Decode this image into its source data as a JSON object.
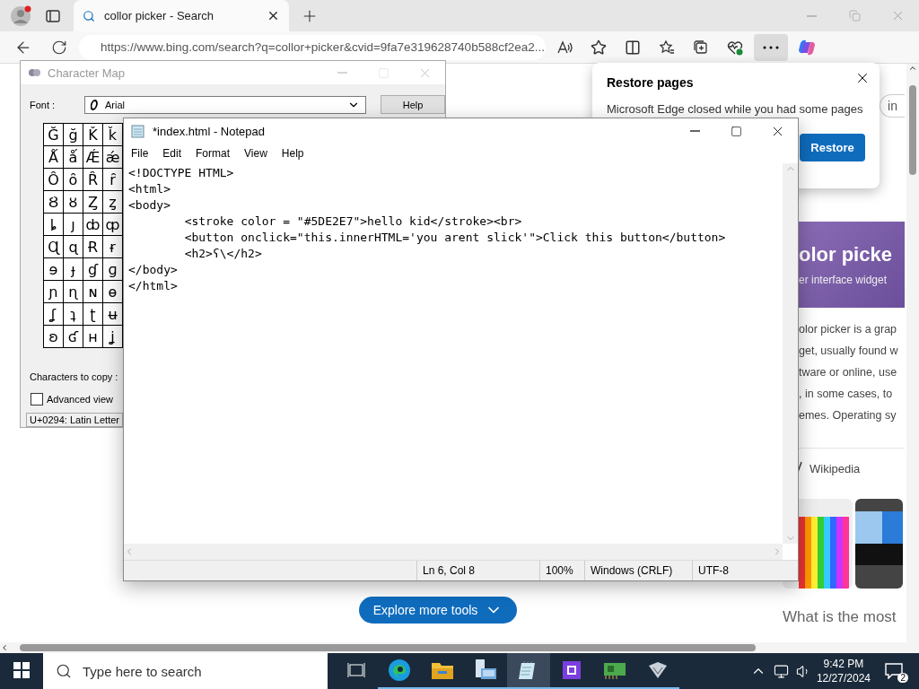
{
  "browser": {
    "tabs": [
      {
        "title": "collor picker - Search",
        "selected": true
      }
    ],
    "address": "https://www.bing.com/search?q=collor+picker&cvid=9fa7e319628740b588cf2ea2...",
    "toolbar": [
      {
        "kind": "read",
        "selected": false
      },
      {
        "kind": "star",
        "selected": false
      },
      {
        "kind": "split",
        "selected": false
      },
      {
        "kind": "favorites",
        "selected": false
      },
      {
        "kind": "collections",
        "selected": false
      },
      {
        "kind": "heart",
        "selected": false
      },
      {
        "kind": "more",
        "selected": true
      },
      {
        "kind": "copilot",
        "selected": false
      }
    ],
    "restore_popup": {
      "title": "Restore pages",
      "message": "Microsoft Edge closed while you had some pages",
      "button": "Restore"
    },
    "page": {
      "sign_in_partial": "in",
      "card_title": "olor picke",
      "card_subtitle": "er interface widget",
      "description": [
        "olor picker is a grap",
        "get, usually found w",
        "tware or online, use",
        ", in some cases, to",
        "emes. Operating sy"
      ],
      "source": "Wikipedia",
      "explore_button": "Explore more tools",
      "question": "What is the most"
    }
  },
  "character_map": {
    "title": "Character Map",
    "active": false,
    "font_label": "Font :",
    "font": "Arial",
    "help": "Help",
    "grid": [
      [
        "Ğ",
        "ğ",
        "Ǩ",
        "ǩ"
      ],
      [
        "Ǻ",
        "ǻ",
        "Ǽ",
        "ǽ"
      ],
      [
        "Ȏ",
        "ȏ",
        "Ȓ",
        "ȓ"
      ],
      [
        "Ȣ",
        "ȣ",
        "Ȥ",
        "ȥ"
      ],
      [
        "ȴ",
        "ȷ",
        "ȸ",
        "ȹ"
      ],
      [
        "Ɋ",
        "ɋ",
        "Ɍ",
        "ɍ"
      ],
      [
        "ɘ",
        "ɟ",
        "ɠ",
        "ɡ"
      ],
      [
        "ɲ",
        "ɳ",
        "ɴ",
        "ɵ"
      ],
      [
        "ʆ",
        "ʇ",
        "ʈ",
        "ʉ"
      ],
      [
        "ʚ",
        "ʛ",
        "ʜ",
        "ʝ"
      ]
    ],
    "copy_label": "Characters to copy :",
    "advanced_view": {
      "label": "Advanced view",
      "checked": false
    },
    "status": "U+0294: Latin Letter"
  },
  "notepad": {
    "title": "*index.html - Notepad",
    "active": true,
    "menu": [
      "File",
      "Edit",
      "Format",
      "View",
      "Help"
    ],
    "lines": [
      "<!DOCTYPE HTML>",
      "<html>",
      "<body>",
      "\t<stroke color = \"#5DE2E7\">hello kid</stroke><br>",
      "\t<button onclick=\"this.innerHTML='you arent slick'\">Click this button</button>",
      "\t<h2>ʕ\\</h2>",
      "</body>",
      "</html>"
    ],
    "status": [
      "Ln 6, Col 8",
      "100%",
      "Windows (CRLF)",
      "UTF-8"
    ]
  },
  "taskbar": {
    "search_placeholder": "Type here to search",
    "apps": [
      {
        "kind": "taskview",
        "selected": false
      },
      {
        "kind": "edge",
        "selected": false
      },
      {
        "kind": "folder",
        "selected": false
      },
      {
        "kind": "server",
        "selected": false
      },
      {
        "kind": "notepad",
        "selected": true
      },
      {
        "kind": "chip",
        "selected": false
      },
      {
        "kind": "card",
        "selected": false
      },
      {
        "kind": "tool",
        "selected": false
      }
    ],
    "time": "9:42 PM",
    "date": "12/27/2024",
    "notifications": "2"
  }
}
